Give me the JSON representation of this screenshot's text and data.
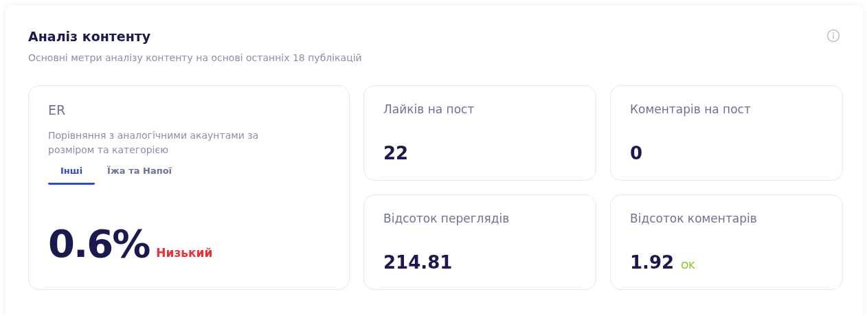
{
  "title": "Аналіз контенту",
  "subtitle": "Основні метри аналізу контенту на основі останніх 18 публікацій",
  "er": {
    "label": "ER",
    "description": "Порівняння з аналогічними акаунтами за розміром та категорією",
    "tabs": [
      {
        "label": "Інші",
        "selected": true
      },
      {
        "label": "Їжа та Напої",
        "selected": false
      }
    ],
    "value": "0.6%",
    "status": {
      "text": "Низький",
      "color": "#e8323c"
    }
  },
  "metrics": [
    {
      "label": "Лайків на пост",
      "value": "22"
    },
    {
      "label": "Коментарів на пост",
      "value": "0"
    },
    {
      "label": "Відсоток переглядів",
      "value": "214.81"
    },
    {
      "label": "Відсоток коментарів",
      "value": "1.92",
      "status": {
        "text": "OK",
        "color": "#7cc417"
      }
    }
  ]
}
